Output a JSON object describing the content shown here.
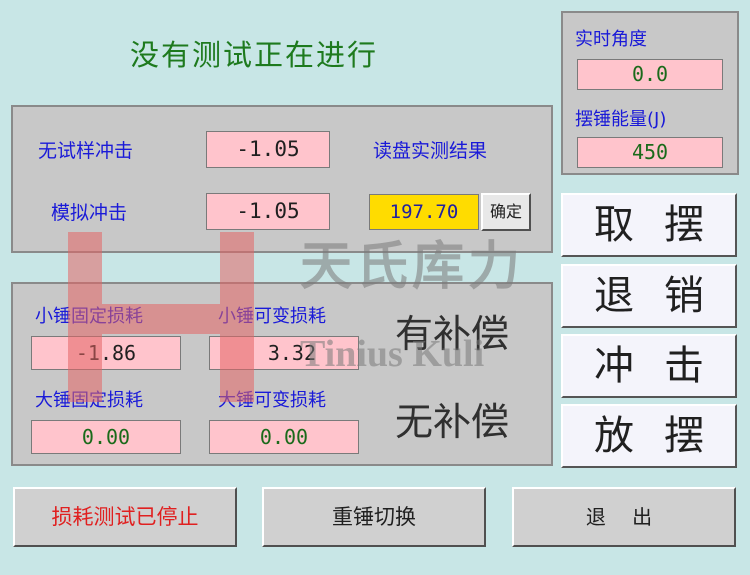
{
  "status_title": "没有测试正在进行",
  "angle": {
    "label": "实时角度",
    "value": "0.0"
  },
  "energy": {
    "label": "摆锤能量(J)",
    "value": "450"
  },
  "impact_panel": {
    "no_sample_label": "无试样冲击",
    "no_sample_value": "-1.05",
    "simulate_label": "模拟冲击",
    "simulate_value": "-1.05",
    "dial_label": "读盘实测结果",
    "dial_value": "197.70",
    "confirm_label": "确定"
  },
  "loss_panel": {
    "small_fixed_label": "小锤固定损耗",
    "small_fixed_value": "-1.86",
    "small_var_label": "小锤可变损耗",
    "small_var_value": "3.32",
    "big_fixed_label": "大锤固定损耗",
    "big_fixed_value": "0.00",
    "big_var_label": "大锤可变损耗",
    "big_var_value": "0.00",
    "compensated_label": "有补偿",
    "uncompensated_label": "无补偿"
  },
  "side_buttons": [
    "取摆",
    "退销",
    "冲击",
    "放摆"
  ],
  "bottom_buttons": {
    "loss_test_status": "损耗测试已停止",
    "switch_hammer": "重锤切换",
    "exit": "退 出"
  },
  "watermark": {
    "cn": "天氏库力",
    "en": "Tinius Kuli",
    "reg": "®"
  },
  "colors": {
    "background": "#c8e6e6",
    "value_box": "#ffc4cc",
    "highlight": "#ffdc00",
    "title_green": "#1e7a1e",
    "label_blue": "#1a1ad8",
    "status_red": "#e02020"
  }
}
